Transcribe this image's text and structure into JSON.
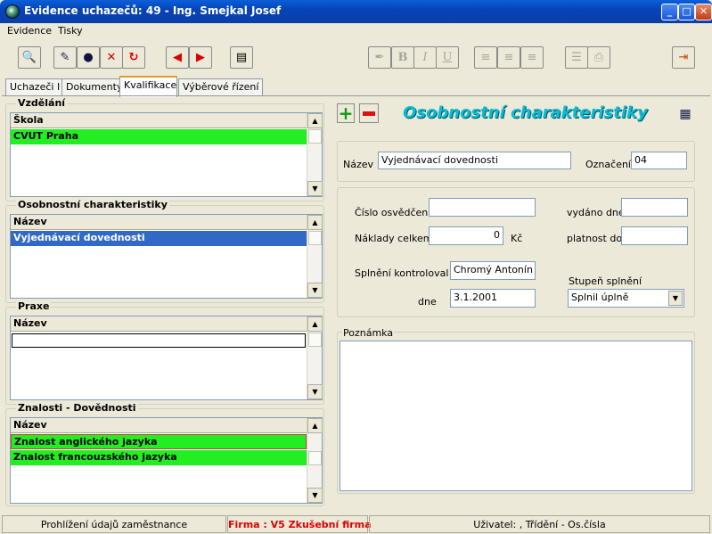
{
  "window": {
    "title": "Evidence uchazečů: 49 - Ing. Smejkal Josef",
    "minimize": "_",
    "maximize": "□",
    "close": "✕"
  },
  "menu": [
    {
      "label": "Evidence"
    },
    {
      "label": "Tisky"
    }
  ],
  "tabs": [
    {
      "label": "Uchazeči I"
    },
    {
      "label": "Dokumenty"
    },
    {
      "label": "Kvalifikace"
    },
    {
      "label": "Výběrové řízení"
    }
  ],
  "left": {
    "vzdelani": {
      "title": "Vzdělání",
      "header": "Škola",
      "rows": [
        "CVUT Praha"
      ]
    },
    "osobnostni": {
      "title": "Osobnostní charakteristiky",
      "header": "Název",
      "rows": [
        "Vyjednávací dovednosti"
      ]
    },
    "praxe": {
      "title": "Praxe",
      "header": "Název",
      "rows": [
        ""
      ]
    },
    "znalosti": {
      "title": "Znalosti - Dovědnosti",
      "header": "Název",
      "rows": [
        "Znalost anglického jazyka",
        "Znalost francouzského jazyka"
      ]
    }
  },
  "right": {
    "heading": "Osobnostní charakteristiky",
    "nazev_label": "Název",
    "nazev_value": "Vyjednávací dovednosti",
    "oznaceni_label": "Označení",
    "oznaceni_value": "04",
    "cislo_label": "Číslo osvědčení",
    "cislo_value": "",
    "vydano_label": "vydáno dne",
    "vydano_value": "",
    "naklady_label": "Náklady celkem",
    "naklady_value": "0",
    "naklady_unit": "Kč",
    "platnost_label": "platnost do",
    "platnost_value": "",
    "splneni_label": "Splnění kontroloval",
    "splneni_value": "Chromý Antonín",
    "dne_label": "dne",
    "dne_value": "3.1.2001",
    "stupen_label": "Stupeň splnění",
    "stupen_value": "Splnil úplně",
    "poznamka_label": "Poznámka",
    "poznamka_value": ""
  },
  "status": {
    "left": "Prohlížení údajů zaměstnance",
    "middle": "Firma :  V5 Zkušební firma",
    "right": "Uživatel: , Třídění - Os.čísla"
  },
  "colors": {
    "highlight_green": "#22ee22",
    "selection_blue": "#316ac5",
    "heading_teal": "#0bbcd4",
    "firma_red": "#dd0000"
  },
  "icons": {
    "toolbar": [
      "search-icon",
      "person-edit-icon",
      "person-icon",
      "person-delete-icon",
      "refresh-icon",
      "arrow-left-icon",
      "arrow-right-icon",
      "report-icon",
      "font-icon",
      "bold-icon",
      "italic-icon",
      "underline-icon",
      "align-left-icon",
      "align-center-icon",
      "align-right-icon",
      "list-icon",
      "print-icon",
      "exit-door-icon"
    ]
  }
}
